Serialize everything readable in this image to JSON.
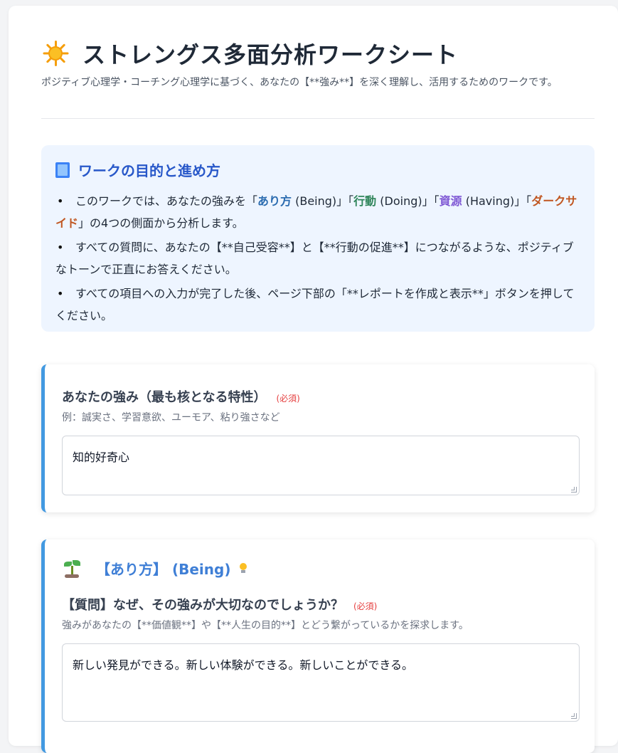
{
  "header": {
    "title": "ストレングス多面分析ワークシート",
    "subtitle": "ポジティブ心理学・コーチング心理学に基づく、あなたの【**強み**】を深く理解し、活用するためのワークです。"
  },
  "info": {
    "title": "ワークの目的と進め方",
    "item1": {
      "p1": "このワークでは、あなたの強みを「",
      "being": "あり方",
      "p2": " (Being)」「",
      "doing": "行動",
      "p3": " (Doing)」「",
      "having": "資源",
      "p4": " (Having)」「",
      "dark": "ダークサイド",
      "p5": "」の4つの側面から分析します。"
    },
    "item2": "すべての質問に、あなたの【**自己受容**】と【**行動の促進**】につながるような、ポジティブなトーンで正直にお答えください。",
    "item3": "すべての項目への入力が完了した後、ページ下部の「**レポートを作成と表示**」ボタンを押してください。"
  },
  "strength": {
    "label": "あなたの強み（最も核となる特性）",
    "required": "(必須)",
    "hint": "例：誠実さ、学習意欲、ユーモア、粘り強さなど",
    "value": "知的好奇心"
  },
  "being": {
    "section_title": "【あり方】 (Being)",
    "question": "【質問】なぜ、その強みが大切なのでしょうか？",
    "required": "(必須)",
    "hint": "強みがあなたの【**価値観**】や【**人生の目的**】とどう繋がっているかを探求します。",
    "value": "新しい発見ができる。新しい体験ができる。新しいことができる。"
  }
}
